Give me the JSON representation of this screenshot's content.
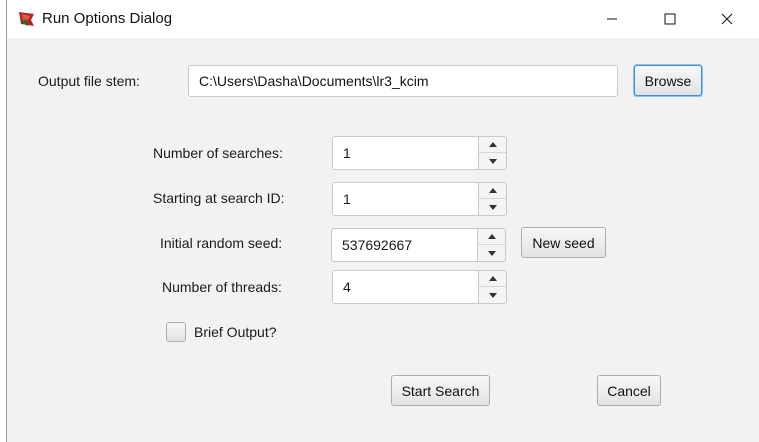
{
  "window": {
    "title": "Run Options Dialog",
    "icon": "app-logo-icon",
    "controls": [
      "minimize-icon",
      "maximize-icon",
      "close-icon"
    ]
  },
  "output": {
    "label": "Output file stem:",
    "value": "C:\\Users\\Dasha\\Documents\\lr3_kcim",
    "browse_label": "Browse"
  },
  "searches": {
    "label": "Number of searches:",
    "value": "1"
  },
  "start_id": {
    "label": "Starting at search ID:",
    "value": "1"
  },
  "seed": {
    "label": "Initial random seed:",
    "value": "537692667",
    "new_seed_label": "New seed"
  },
  "threads": {
    "label": "Number of threads:",
    "value": "4"
  },
  "brief": {
    "label": "Brief Output?",
    "checked": false
  },
  "actions": {
    "start_label": "Start Search",
    "cancel_label": "Cancel"
  },
  "colors": {
    "focus_border": "#3b8fd8",
    "dialog_bg": "#f2f2f2"
  }
}
